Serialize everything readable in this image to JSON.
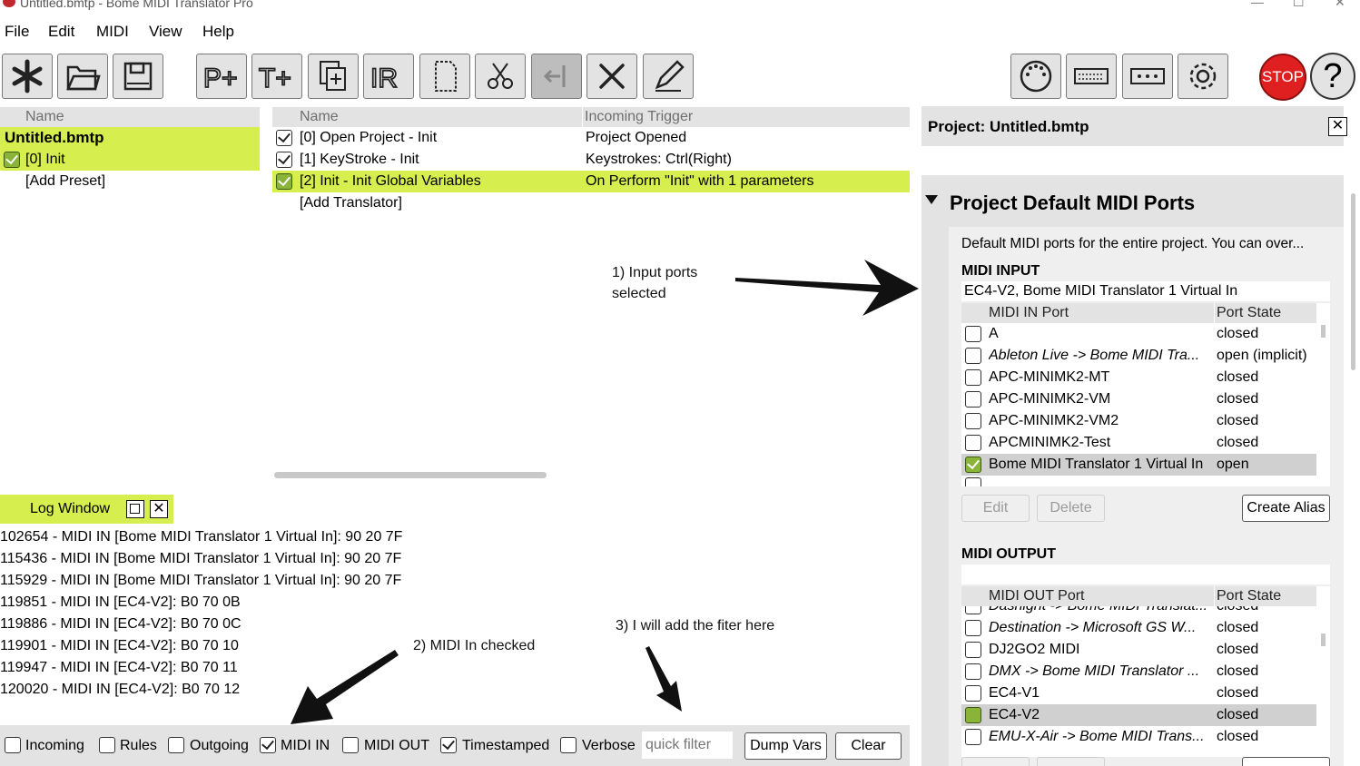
{
  "window": {
    "title": "Untitled.bmtp - Bome MIDI Translator Pro"
  },
  "menu": [
    "File",
    "Edit",
    "MIDI",
    "View",
    "Help"
  ],
  "toolbar": {
    "right_stop": "STOP",
    "right_help": "?"
  },
  "presets": {
    "header": "Name",
    "project": "Untitled.bmtp",
    "items": [
      {
        "label": "[0] Init",
        "checked": true
      }
    ],
    "add": "[Add Preset]"
  },
  "translators": {
    "header_name": "Name",
    "header_trigger": "Incoming Trigger",
    "rows": [
      {
        "name": "[0] Open Project - Init",
        "trigger": "Project Opened"
      },
      {
        "name": "[1] KeyStroke - Init",
        "trigger": "Keystrokes: Ctrl(Right)"
      },
      {
        "name": "[2] Init - Init Global Variables",
        "trigger": "On Perform \"Init\" with 1 parameters"
      }
    ],
    "add": "[Add Translator]"
  },
  "annotations": {
    "a1_line1": "1) Input ports",
    "a1_line2": "selected",
    "a2": "2) MIDI In checked",
    "a3": "3) I will add the fiter here"
  },
  "log": {
    "title": "Log Window",
    "lines": [
      "102654 - MIDI IN [Bome MIDI Translator 1 Virtual In]: 90 20 7F",
      "115436 - MIDI IN [Bome MIDI Translator 1 Virtual In]: 90 20 7F",
      "115929 - MIDI IN [Bome MIDI Translator 1 Virtual In]: 90 20 7F",
      "119851 - MIDI IN [EC4-V2]: B0 70 0B",
      "119886 - MIDI IN [EC4-V2]: B0 70 0C",
      "119901 - MIDI IN [EC4-V2]: B0 70 10",
      "119947 - MIDI IN [EC4-V2]: B0 70 11",
      "120020 - MIDI IN [EC4-V2]: B0 70 12"
    ],
    "filters": {
      "incoming": "Incoming",
      "rules": "Rules",
      "outgoing": "Outgoing",
      "midi_in": "MIDI IN",
      "midi_out": "MIDI OUT",
      "timestamped": "Timestamped",
      "verbose": "Verbose"
    },
    "quick_filter_placeholder": "quick filter",
    "dump_vars": "Dump Vars",
    "clear": "Clear"
  },
  "project": {
    "title": "Project: Untitled.bmtp",
    "section": "Project Default MIDI Ports",
    "description": "Default MIDI ports for the entire project. You can over...",
    "midi_input_label": "MIDI INPUT",
    "midi_input_value": "EC4-V2, Bome MIDI Translator 1 Virtual In",
    "in_header_port": "MIDI IN Port",
    "in_header_state": "Port State",
    "in_ports": [
      {
        "name": "A",
        "state": "closed",
        "checked": false,
        "italic": false
      },
      {
        "name": "Ableton Live -> Bome MIDI Tra...",
        "state": "open (implicit)",
        "checked": false,
        "italic": true
      },
      {
        "name": "APC-MINIMK2-MT",
        "state": "closed",
        "checked": false,
        "italic": false
      },
      {
        "name": "APC-MINIMK2-VM",
        "state": "closed",
        "checked": false,
        "italic": false
      },
      {
        "name": "APC-MINIMK2-VM2",
        "state": "closed",
        "checked": false,
        "italic": false
      },
      {
        "name": "APCMINIMK2-Test",
        "state": "closed",
        "checked": false,
        "italic": false
      },
      {
        "name": "Bome MIDI Translator 1 Virtual In",
        "state": "open",
        "checked": true,
        "italic": false
      }
    ],
    "edit": "Edit",
    "delete": "Delete",
    "create_alias": "Create Alias",
    "midi_output_label": "MIDI OUTPUT",
    "midi_output_value": "",
    "out_header_port": "MIDI OUT Port",
    "out_header_state": "Port State",
    "out_ports": [
      {
        "name": "Dasnight -> Bome MIDI Translat...",
        "state": "closed",
        "checked": false,
        "italic": true
      },
      {
        "name": "Destination -> Microsoft GS W...",
        "state": "closed",
        "checked": false,
        "italic": true
      },
      {
        "name": "DJ2GO2 MIDI",
        "state": "closed",
        "checked": false,
        "italic": false
      },
      {
        "name": "DMX -> Bome MIDI Translator ...",
        "state": "closed",
        "checked": false,
        "italic": true
      },
      {
        "name": "EC4-V1",
        "state": "closed",
        "checked": false,
        "italic": false
      },
      {
        "name": "EC4-V2",
        "state": "closed",
        "checked": "partial",
        "italic": false
      },
      {
        "name": "EMU-X-Air -> Bome MIDI Trans...",
        "state": "closed",
        "checked": false,
        "italic": true
      }
    ]
  },
  "colors": {
    "selection": "#d6ee4e",
    "check_green": "#8ab33a",
    "stop_red": "#e02020"
  }
}
